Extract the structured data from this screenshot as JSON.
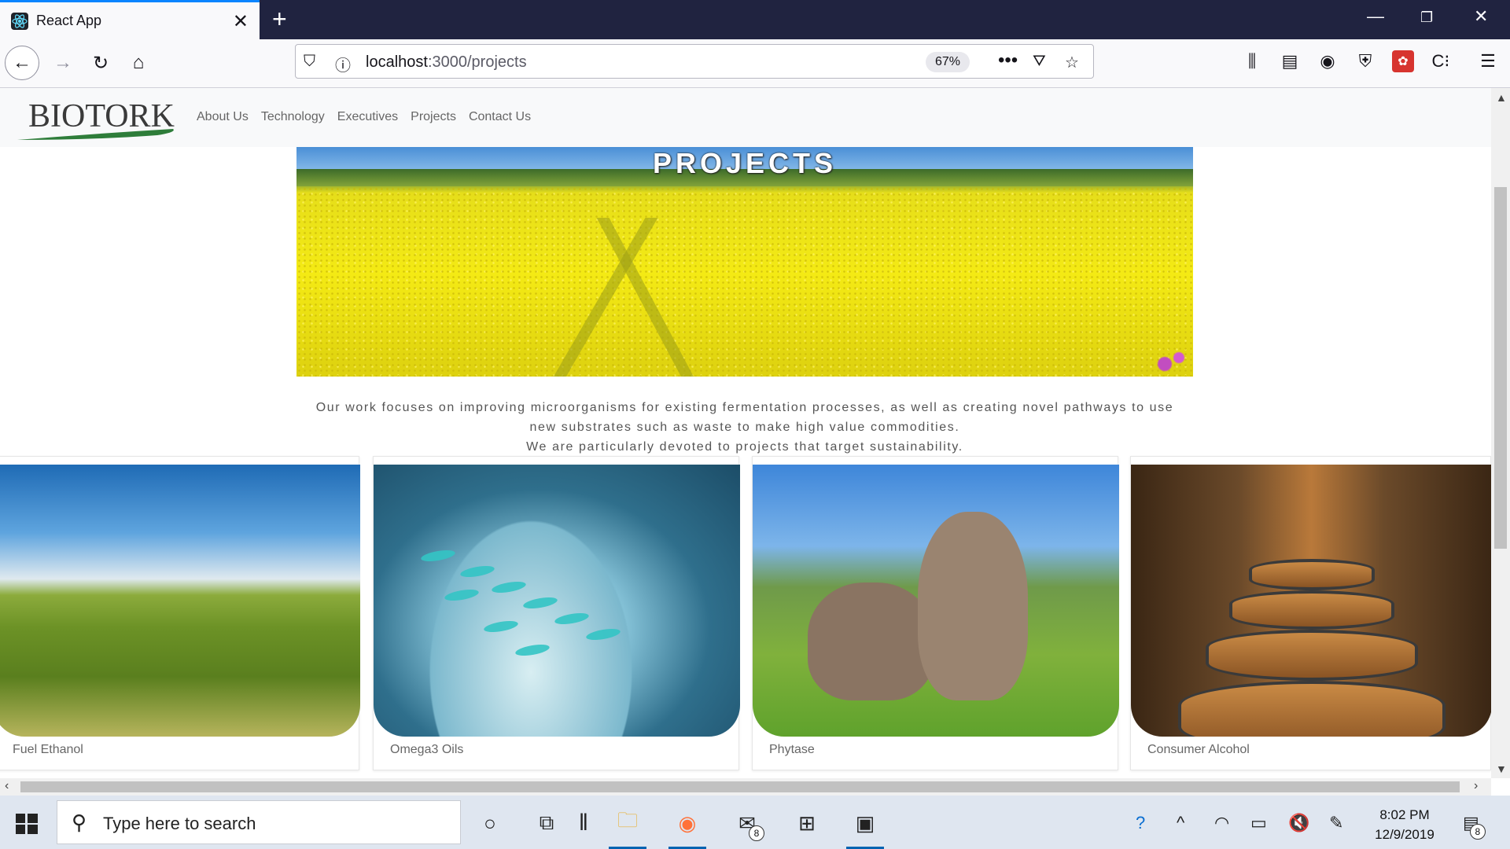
{
  "browser": {
    "tab_title": "React App",
    "url_host": "localhost",
    "url_path": ":3000/projects",
    "zoom": "67%"
  },
  "site": {
    "logo_text": "BIOTORK",
    "nav": [
      "About Us",
      "Technology",
      "Executives",
      "Projects",
      "Contact Us"
    ],
    "hero_title": "PROJECTS",
    "intro_lines": [
      "Our work focuses on improving microorganisms for existing fermentation processes, as well as creating novel pathways to use",
      "new substrates such as waste to make high value commodities.",
      "We are particularly devoted to projects that target sustainability."
    ],
    "projects": [
      {
        "name": "Fuel Ethanol",
        "icon": "wheat-field-image"
      },
      {
        "name": "Omega3 Oils",
        "icon": "fish-school-image"
      },
      {
        "name": "Phytase",
        "icon": "cows-grazing-image"
      },
      {
        "name": "Consumer Alcohol",
        "icon": "barrels-image"
      }
    ]
  },
  "taskbar": {
    "search_placeholder": "Type here to search",
    "mail_badge": "8",
    "notif_badge": "8",
    "time": "8:02 PM",
    "date": "12/9/2019"
  },
  "colors": {
    "tabstrip": "#202340",
    "accent": "#0a84ff",
    "hero_yellow": "#f4ea14"
  }
}
